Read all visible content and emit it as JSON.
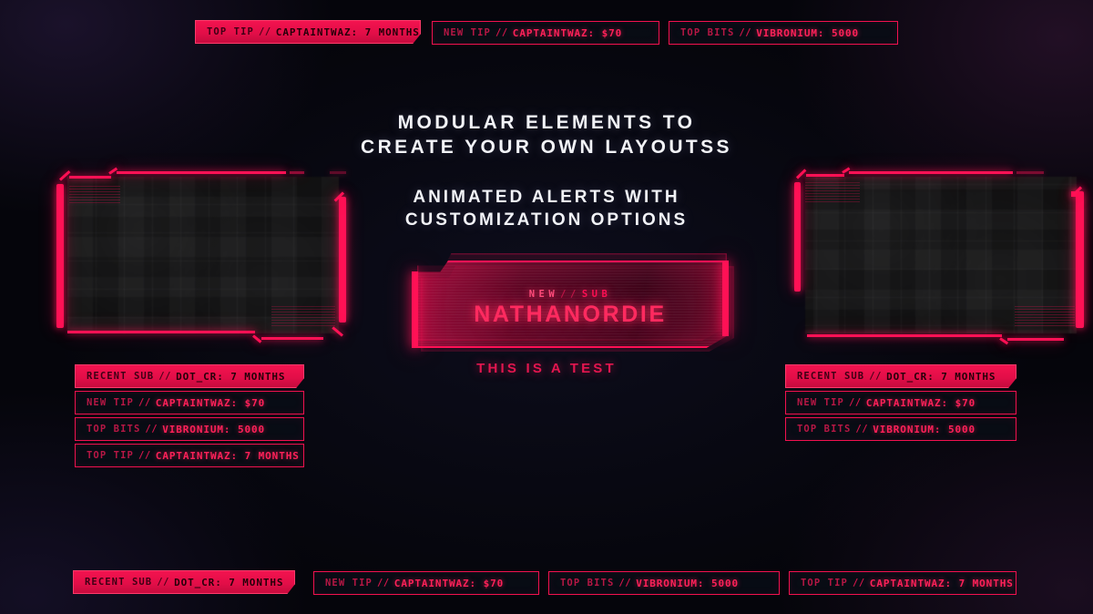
{
  "headings": {
    "main_line1": "MODULAR ELEMENTS TO",
    "main_line2": "CREATE YOUR OWN LAYOUTSS",
    "sub_line1": "ANIMATED ALERTS WITH",
    "sub_line2": "CUSTOMIZATION OPTIONS"
  },
  "alert": {
    "kicker_prefix": "NEW",
    "kicker_sep": "//",
    "kicker_kind": "SUB",
    "name": "NATHANORDIE",
    "caption": "THIS IS A TEST"
  },
  "colors": {
    "accent": "#ff1155",
    "accent_deep": "#e30e48",
    "accent_dark": "#b81745",
    "text_light": "#f2f3f7",
    "background": "#05060c"
  },
  "top_banners": [
    {
      "label": "TOP TIP",
      "sep": "//",
      "value": "CAPTAINTWAZ: 7 MONTHS",
      "filled": true
    },
    {
      "label": "NEW TIP",
      "sep": "//",
      "value": "CAPTAINTWAZ: $70",
      "filled": false
    },
    {
      "label": "TOP BITS",
      "sep": "//",
      "value": "VIBRONIUM: 5000",
      "filled": false
    }
  ],
  "left_banners": [
    {
      "label": "RECENT SUB",
      "sep": "//",
      "value": "DOT_CR: 7 MONTHS",
      "filled": true
    },
    {
      "label": "NEW TIP",
      "sep": "//",
      "value": "CAPTAINTWAZ: $70",
      "filled": false
    },
    {
      "label": "TOP BITS",
      "sep": "//",
      "value": "VIBRONIUM: 5000",
      "filled": false
    },
    {
      "label": "TOP TIP",
      "sep": "//",
      "value": "CAPTAINTWAZ: 7 MONTHS",
      "filled": false
    }
  ],
  "right_banners": [
    {
      "label": "RECENT SUB",
      "sep": "//",
      "value": "DOT_CR: 7 MONTHS",
      "filled": true
    },
    {
      "label": "NEW TIP",
      "sep": "//",
      "value": "CAPTAINTWAZ: $70",
      "filled": false
    },
    {
      "label": "TOP BITS",
      "sep": "//",
      "value": "VIBRONIUM: 5000",
      "filled": false
    }
  ],
  "bottom_banners": [
    {
      "label": "RECENT SUB",
      "sep": "//",
      "value": "DOT_CR: 7 MONTHS",
      "filled": true
    },
    {
      "label": "NEW TIP",
      "sep": "//",
      "value": "CAPTAINTWAZ: $70",
      "filled": false
    },
    {
      "label": "TOP BITS",
      "sep": "//",
      "value": "VIBRONIUM: 5000",
      "filled": false
    },
    {
      "label": "TOP TIP",
      "sep": "//",
      "value": "CAPTAINTWAZ: 7 MONTHS",
      "filled": false
    }
  ],
  "cameras": [
    {
      "name": "left-webcam-frame"
    },
    {
      "name": "right-webcam-frame"
    }
  ]
}
